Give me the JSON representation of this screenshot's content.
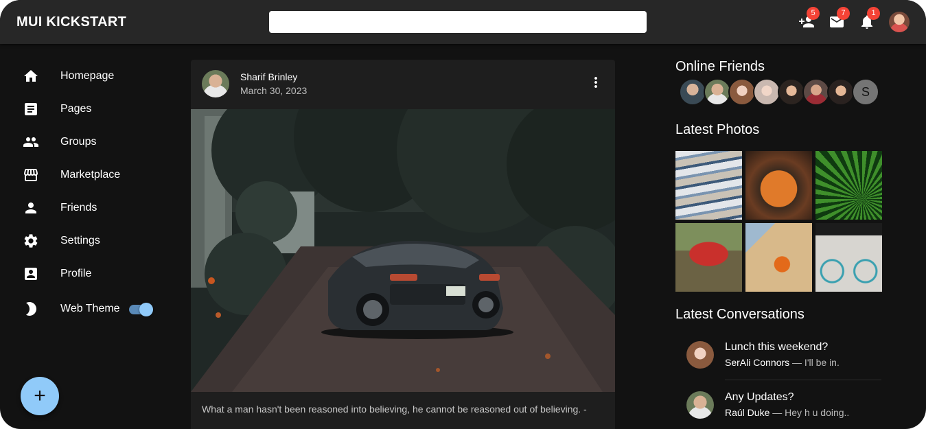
{
  "app": {
    "title": "MUI KICKSTART"
  },
  "search": {
    "placeholder": "",
    "value": ""
  },
  "header": {
    "friend_requests_badge": "5",
    "messages_badge": "7",
    "notifications_badge": "1"
  },
  "sidebar": {
    "items": [
      {
        "label": "Homepage",
        "icon": "home-icon"
      },
      {
        "label": "Pages",
        "icon": "article-icon"
      },
      {
        "label": "Groups",
        "icon": "group-icon"
      },
      {
        "label": "Marketplace",
        "icon": "storefront-icon"
      },
      {
        "label": "Friends",
        "icon": "person-icon"
      },
      {
        "label": "Settings",
        "icon": "settings-icon"
      },
      {
        "label": "Profile",
        "icon": "account-box-icon"
      }
    ],
    "theme_toggle": {
      "label": "Web Theme",
      "icon": "moon-icon",
      "checked": true
    }
  },
  "fab": {
    "label": "+"
  },
  "post": {
    "author": "Sharif Brinley",
    "date": "March 30, 2023",
    "text": "What a man hasn't been reasoned into believing, he cannot be reasoned out of believing. -"
  },
  "rightbar": {
    "online_friends_title": "Online Friends",
    "extra_friend_initial": "S",
    "latest_photos_title": "Latest Photos",
    "latest_conversations_title": "Latest Conversations",
    "conversations": [
      {
        "title": "Lunch this weekend?",
        "sender": "SerAli Connors",
        "preview": " — I'll be in."
      },
      {
        "title": "Any Updates?",
        "sender": "Raúl Duke",
        "preview": " — Hey h u doing.."
      }
    ]
  },
  "colors": {
    "background": "#121212",
    "appbar": "#272727",
    "card": "#1e1e1e",
    "accent": "#90caf9",
    "badge": "#f44336"
  }
}
